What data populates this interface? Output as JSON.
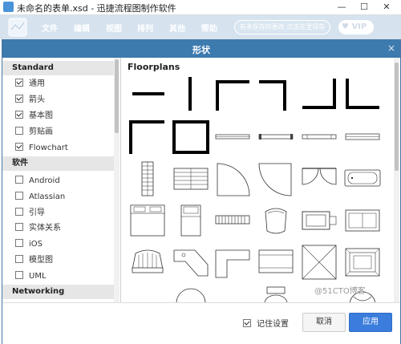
{
  "window": {
    "title": "未命名的表单.xsd - 迅捷流程图制作软件",
    "minimize": "—",
    "maximize": "☐",
    "close": "✕"
  },
  "menu": {
    "items": [
      "文件",
      "编辑",
      "视图",
      "排列",
      "其他",
      "帮助"
    ],
    "unsaved_notice": "有未保存的更改 点击这里保存",
    "vip": "VIP"
  },
  "dialog": {
    "title": "形状",
    "close": "×",
    "categories": [
      {
        "name": "Standard",
        "items": [
          {
            "label": "通用",
            "checked": true
          },
          {
            "label": "箭头",
            "checked": true
          },
          {
            "label": "基本图",
            "checked": true
          },
          {
            "label": "剪贴画",
            "checked": false
          },
          {
            "label": "Flowchart",
            "checked": true
          }
        ]
      },
      {
        "name": "软件",
        "items": [
          {
            "label": "Android",
            "checked": false
          },
          {
            "label": "Atlassian",
            "checked": false
          },
          {
            "label": "引导",
            "checked": false
          },
          {
            "label": "实体关系",
            "checked": false
          },
          {
            "label": "iOS",
            "checked": false
          },
          {
            "label": "模型图",
            "checked": false
          },
          {
            "label": "UML",
            "checked": false
          }
        ]
      },
      {
        "name": "Networking",
        "items": []
      }
    ],
    "section_title": "Floorplans",
    "remember_label": "记住设置",
    "remember_checked": true,
    "cancel_label": "取消",
    "apply_label": "应用"
  },
  "watermark": "@51CTO博客",
  "colors": {
    "header": "#3d7aae",
    "menubar": "#d6e3ef",
    "apply": "#3b7ddd"
  }
}
